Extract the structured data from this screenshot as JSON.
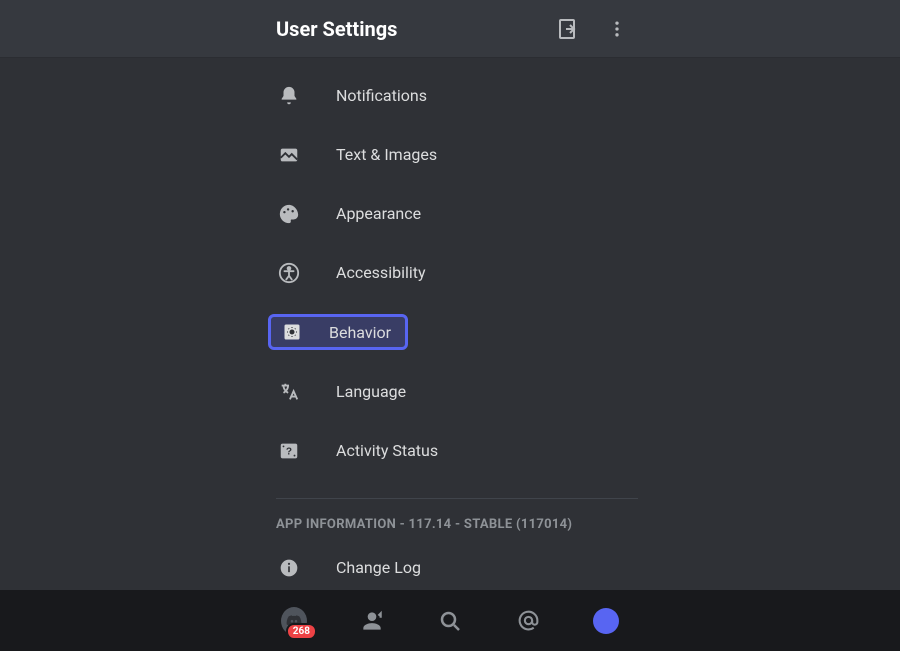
{
  "header": {
    "title": "User Settings"
  },
  "settings": {
    "items": [
      {
        "label": "Notifications"
      },
      {
        "label": "Text & Images"
      },
      {
        "label": "Appearance"
      },
      {
        "label": "Accessibility"
      },
      {
        "label": "Behavior"
      },
      {
        "label": "Language"
      },
      {
        "label": "Activity Status"
      }
    ]
  },
  "section": {
    "app_info": "APP INFORMATION - 117.14 - STABLE (117014)",
    "items": [
      {
        "label": "Change Log"
      }
    ]
  },
  "bottom_bar": {
    "badge_count": "268"
  }
}
